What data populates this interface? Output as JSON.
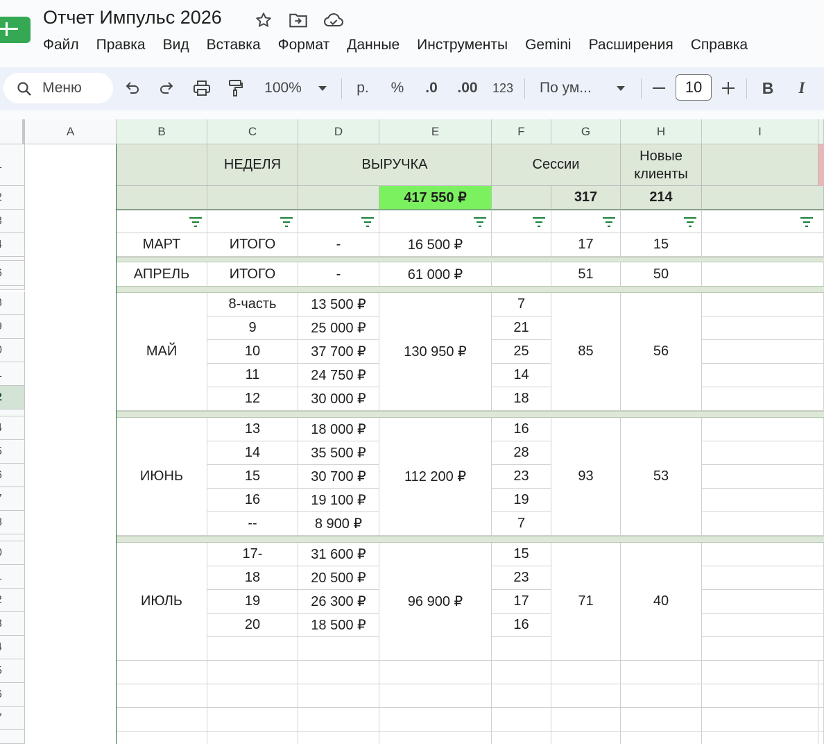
{
  "app": {
    "doc_title": "Отчет Импульс 2026",
    "menu": [
      "Файл",
      "Правка",
      "Вид",
      "Вставка",
      "Формат",
      "Данные",
      "Инструменты",
      "Gemini",
      "Расширения",
      "Справка"
    ]
  },
  "toolbar": {
    "search_label": "Меню",
    "zoom": "100%",
    "currency": "р.",
    "percent": "%",
    "decrease_decimal": ".0",
    "increase_decimal": ".00",
    "number_format": "123",
    "font_name": "По ум...",
    "font_size": "10",
    "bold": "B",
    "italic": "I"
  },
  "columns": [
    "A",
    "B",
    "C",
    "D",
    "E",
    "F",
    "G",
    "H",
    "I"
  ],
  "row_numbers": [
    "1",
    "2",
    "3",
    "4",
    "6",
    "8",
    "9",
    "0",
    "1",
    "2",
    "4",
    "5",
    "6",
    "7",
    "8",
    "0",
    "1",
    "2",
    "3",
    "4",
    "5",
    "6",
    "7"
  ],
  "header": {
    "week": "НЕДЕЛЯ",
    "revenue": "ВЫРУЧКА",
    "sessions": "Сессии",
    "new_clients_1": "Новые",
    "new_clients_2": "клиенты",
    "total_revenue": "417 550 ₽",
    "total_sessions": "317",
    "total_new_clients": "214"
  },
  "months": {
    "mar": {
      "name": "МАРТ",
      "week": "ИТОГО",
      "rev": "-",
      "total": "16 500 ₽",
      "sessions": "17",
      "clients": "15"
    },
    "apr": {
      "name": "АПРЕЛЬ",
      "week": "ИТОГО",
      "rev": "-",
      "total": "61 000 ₽",
      "sessions": "51",
      "clients": "50"
    },
    "may": {
      "name": "МАЙ",
      "total": "130 950 ₽",
      "sessions_total": "85",
      "clients": "56",
      "weeks": [
        {
          "w": "8-часть",
          "rev": "13 500 ₽",
          "s": "7"
        },
        {
          "w": "9",
          "rev": "25 000 ₽",
          "s": "21"
        },
        {
          "w": "10",
          "rev": "37 700 ₽",
          "s": "25"
        },
        {
          "w": "11",
          "rev": "24 750 ₽",
          "s": "14"
        },
        {
          "w": "12",
          "rev": "30 000 ₽",
          "s": "18"
        }
      ]
    },
    "jun": {
      "name": "ИЮНЬ",
      "total": "112 200 ₽",
      "sessions_total": "93",
      "clients": "53",
      "weeks": [
        {
          "w": "13",
          "rev": "18 000 ₽",
          "s": "16"
        },
        {
          "w": "14",
          "rev": "35 500 ₽",
          "s": "28"
        },
        {
          "w": "15",
          "rev": "30 700 ₽",
          "s": "23"
        },
        {
          "w": "16",
          "rev": "19 100 ₽",
          "s": "19"
        },
        {
          "w": "--",
          "rev": "8 900 ₽",
          "s": "7"
        }
      ]
    },
    "jul": {
      "name": "ИЮЛЬ",
      "total": "96 900 ₽",
      "sessions_total": "71",
      "clients": "40",
      "weeks": [
        {
          "w": "17-",
          "rev": "31 600 ₽",
          "s": "15"
        },
        {
          "w": "18",
          "rev": "20 500 ₽",
          "s": "23"
        },
        {
          "w": "19",
          "rev": "26 300 ₽",
          "s": "17"
        },
        {
          "w": "20",
          "rev": "18 500 ₽",
          "s": "16"
        }
      ]
    }
  },
  "colors": {
    "accent_green": "#34a853",
    "total_highlight": "#7cf160",
    "header_fill": "#dde8d9"
  }
}
